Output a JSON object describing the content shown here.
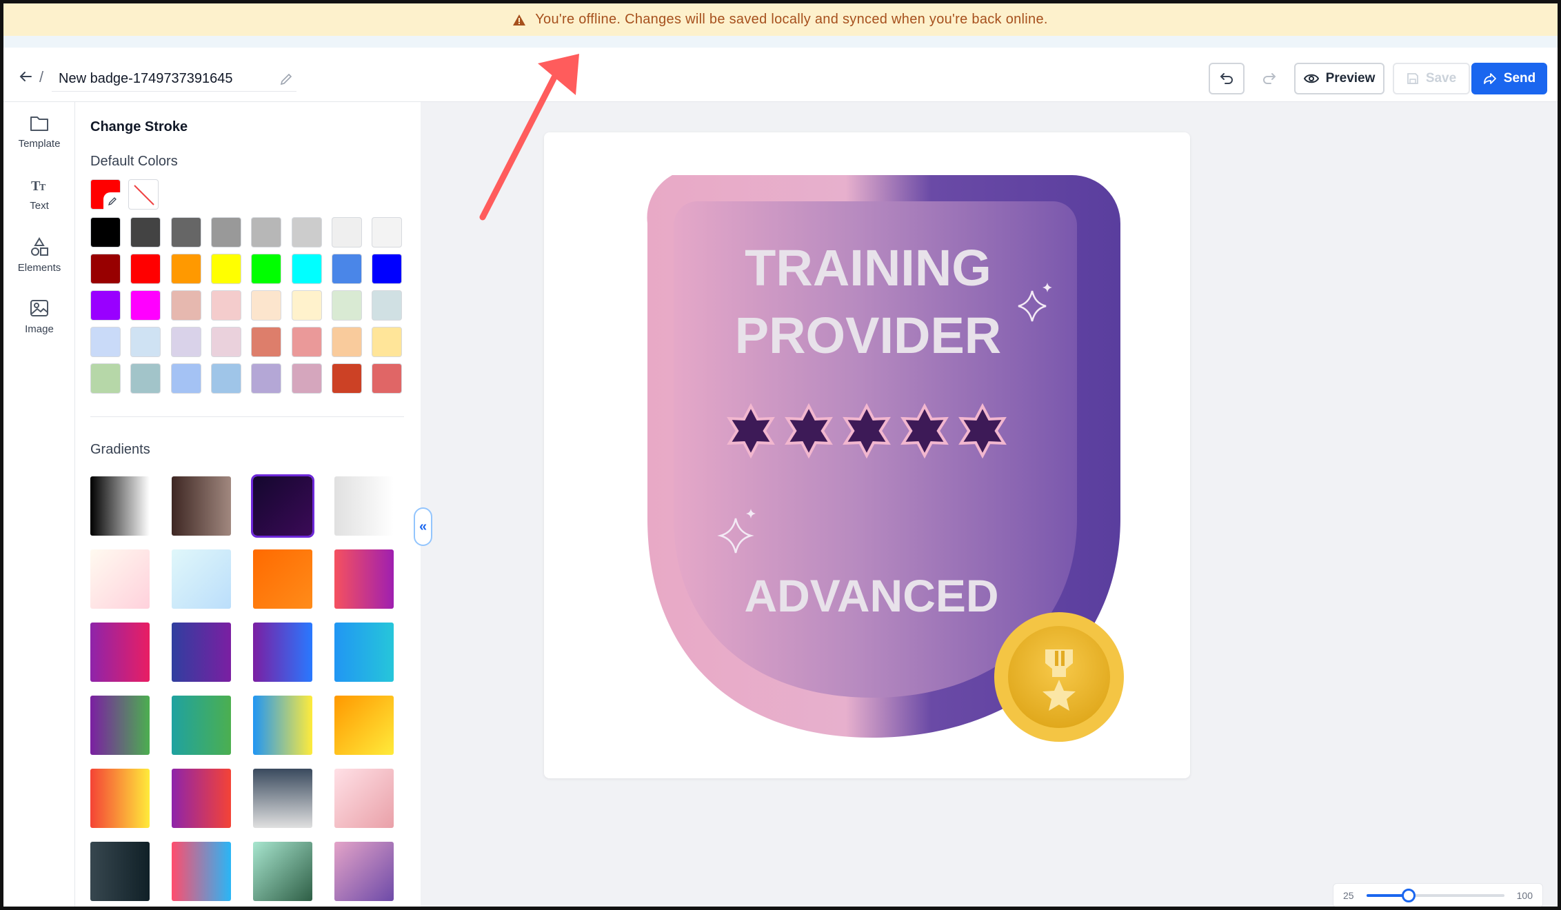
{
  "banner": {
    "message": "You're offline. Changes will be saved locally and synced when you're back online.",
    "icon": "warning-icon"
  },
  "header": {
    "breadcrumb_separator": "/",
    "document_title": "New badge-1749737391645",
    "preview_label": "Preview",
    "save_label": "Save",
    "send_label": "Send"
  },
  "rail": {
    "items": [
      {
        "label": "Template",
        "icon": "folder-icon"
      },
      {
        "label": "Text",
        "icon": "text-icon"
      },
      {
        "label": "Elements",
        "icon": "shapes-icon"
      },
      {
        "label": "Image",
        "icon": "image-icon"
      }
    ]
  },
  "panel": {
    "title": "Change Stroke",
    "default_colors_title": "Default Colors",
    "current_color": "#ff0000",
    "colors": [
      "#000000",
      "#434343",
      "#666666",
      "#999999",
      "#b7b7b7",
      "#cccccc",
      "#efefef",
      "#f3f3f3",
      "#980000",
      "#ff0000",
      "#ff9900",
      "#ffff00",
      "#00ff00",
      "#00ffff",
      "#4a86e8",
      "#0000ff",
      "#9900ff",
      "#ff00ff",
      "#e6b8af",
      "#f4cccc",
      "#fce5cd",
      "#fff2cc",
      "#d9ead3",
      "#d0e0e3",
      "#c9daf8",
      "#cfe2f3",
      "#d9d2e9",
      "#ead1dc",
      "#dd7e6b",
      "#ea9999",
      "#f9cb9c",
      "#ffe599",
      "#b6d7a8",
      "#a2c4c9",
      "#a4c2f4",
      "#9fc5e8",
      "#b4a7d6",
      "#d5a6bd",
      "#cc4125",
      "#e06666"
    ],
    "gradients_title": "Gradients",
    "gradients": [
      "linear-gradient(90deg,#000000,#ffffff)",
      "linear-gradient(90deg,#3e2723,#a1887f)",
      "linear-gradient(135deg,#14072e,#3b0a57)",
      "linear-gradient(90deg,#e0e0e0,#ffffff)",
      "linear-gradient(135deg,#fffaf0,#ffd1dc)",
      "linear-gradient(135deg,#e0f7fa,#bbdefb)",
      "linear-gradient(135deg,#ff6a00,#ff8c1a)",
      "linear-gradient(90deg,#f5515f,#9f1fb0)",
      "linear-gradient(90deg,#8e24aa,#e91e63)",
      "linear-gradient(90deg,#303f9f,#7b1fa2)",
      "linear-gradient(90deg,#7b1fa2,#2979ff)",
      "linear-gradient(90deg,#2196f3,#26c6da)",
      "linear-gradient(90deg,#7b1fa2,#4caf50)",
      "linear-gradient(90deg,#1fa2a0,#4caf50)",
      "linear-gradient(90deg,#2196f3,#ffeb3b)",
      "linear-gradient(135deg,#ff9800,#ffeb3b)",
      "linear-gradient(90deg,#f44336,#ffeb3b)",
      "linear-gradient(90deg,#8e24aa,#f44336)",
      "linear-gradient(180deg,#3a4a5e,#e0e0e0)",
      "linear-gradient(135deg,#ffe0e6,#e9a0a8)",
      "linear-gradient(90deg,#37474f,#102027)",
      "linear-gradient(90deg,#ff4d6d,#29b6f6)",
      "linear-gradient(135deg,#a8e6cf,#2e5e45)",
      "linear-gradient(135deg,#e4a4c8,#6d4aa8)"
    ]
  },
  "badge": {
    "line1": "TRAINING",
    "line2": "PROVIDER",
    "line3": "ADVANCED",
    "star_count": 5
  },
  "zoom": {
    "min_label": "25",
    "max_label": "100",
    "value": 48
  }
}
